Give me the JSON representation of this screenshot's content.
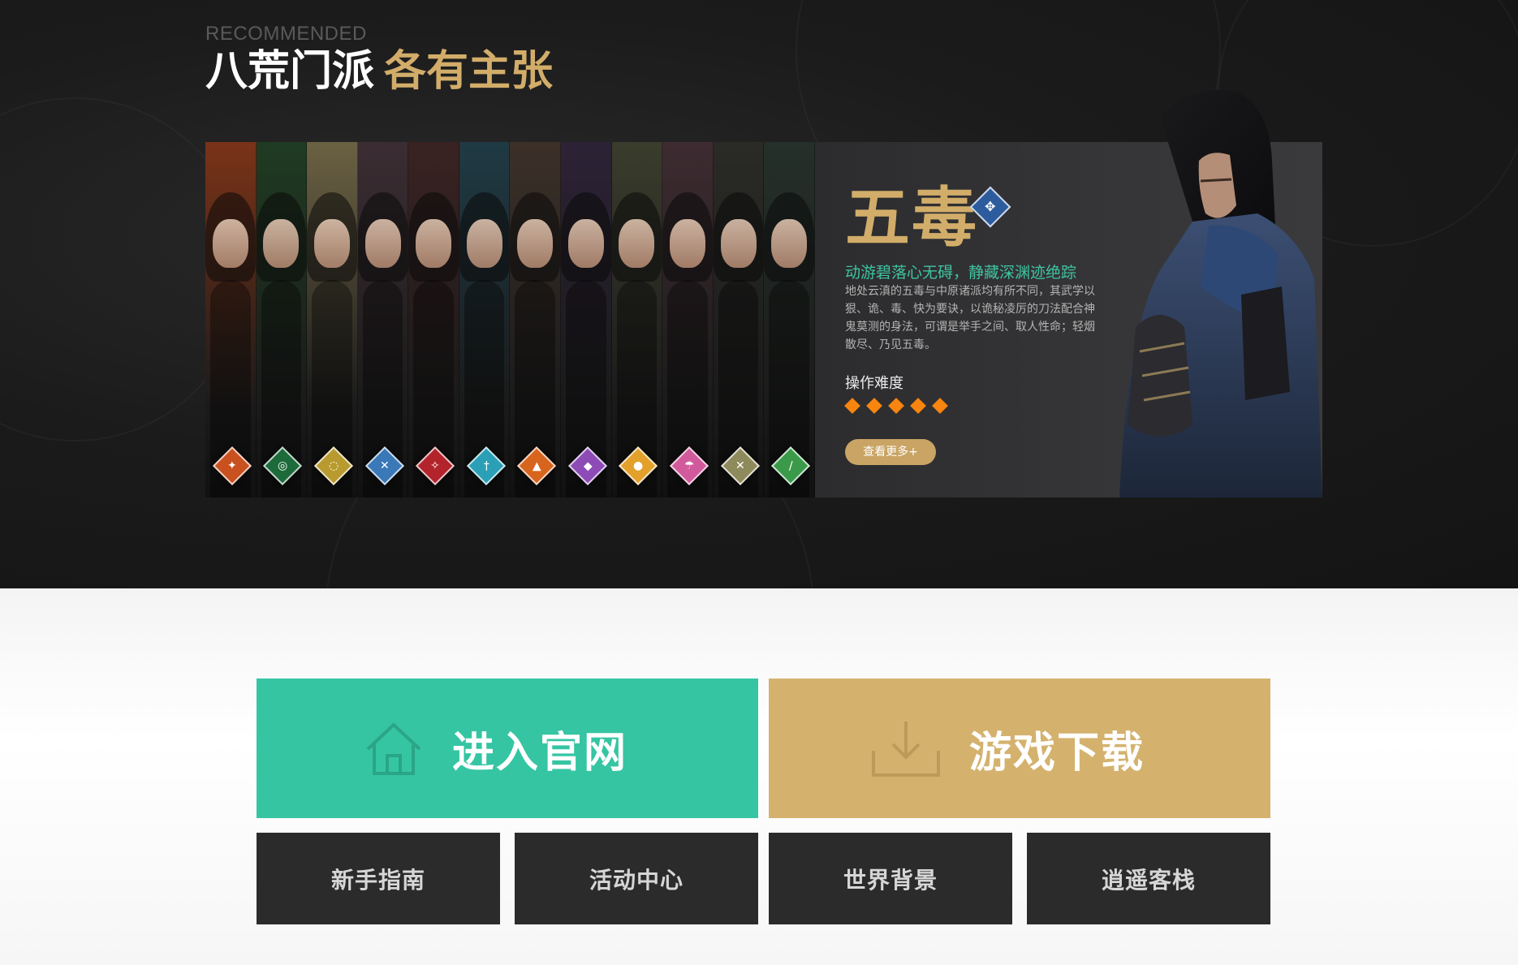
{
  "header": {
    "eyebrow": "RECOMMENDED",
    "title_white": "八荒门派",
    "title_gold": "各有主张"
  },
  "sects": [
    {
      "icon": "blade-emblem-icon",
      "color": "#c9501f",
      "glyph": "✦"
    },
    {
      "icon": "jade-ring-emblem-icon",
      "color": "#1d6a3a",
      "glyph": "◎"
    },
    {
      "icon": "pearl-ring-emblem-icon",
      "color": "#b89a2e",
      "glyph": "◌"
    },
    {
      "icon": "crossed-lines-emblem-icon",
      "color": "#3a78b8",
      "glyph": "✕"
    },
    {
      "icon": "red-blade-emblem-icon",
      "color": "#b3232b",
      "glyph": "✧"
    },
    {
      "icon": "sword-emblem-icon",
      "color": "#2b9fb5",
      "glyph": "†"
    },
    {
      "icon": "flame-emblem-icon",
      "color": "#d8651e",
      "glyph": "▲"
    },
    {
      "icon": "fan-emblem-icon",
      "color": "#8d4bb6",
      "glyph": "◆"
    },
    {
      "icon": "gourd-emblem-icon",
      "color": "#e3a12c",
      "glyph": "●"
    },
    {
      "icon": "umbrella-emblem-icon",
      "color": "#d15a9c",
      "glyph": "☂"
    },
    {
      "icon": "axes-emblem-icon",
      "color": "#8f8a5c",
      "glyph": "✕"
    },
    {
      "icon": "green-blade-emblem-icon",
      "color": "#3b9a4a",
      "glyph": "/"
    }
  ],
  "detail": {
    "name": "五毒",
    "slogan": "动游碧落心无碍，静藏深渊迹绝踪",
    "description": "地处云滇的五毒与中原诸派均有所不同，其武学以狠、诡、毒、快为要诀，以诡秘凌厉的刀法配合神鬼莫测的身法，可谓是举手之间、取人性命；轻烟散尽、乃见五毒。",
    "difficulty_label": "操作难度",
    "difficulty_stars": 5,
    "more_button": "查看更多+",
    "accent_color": "#d2ad6a",
    "slogan_color": "#3fc4a1",
    "star_color": "#f7850f"
  },
  "actions": {
    "official": "进入官网",
    "download": "游戏下载",
    "links": [
      "新手指南",
      "活动中心",
      "世界背景",
      "逍遥客栈"
    ]
  }
}
